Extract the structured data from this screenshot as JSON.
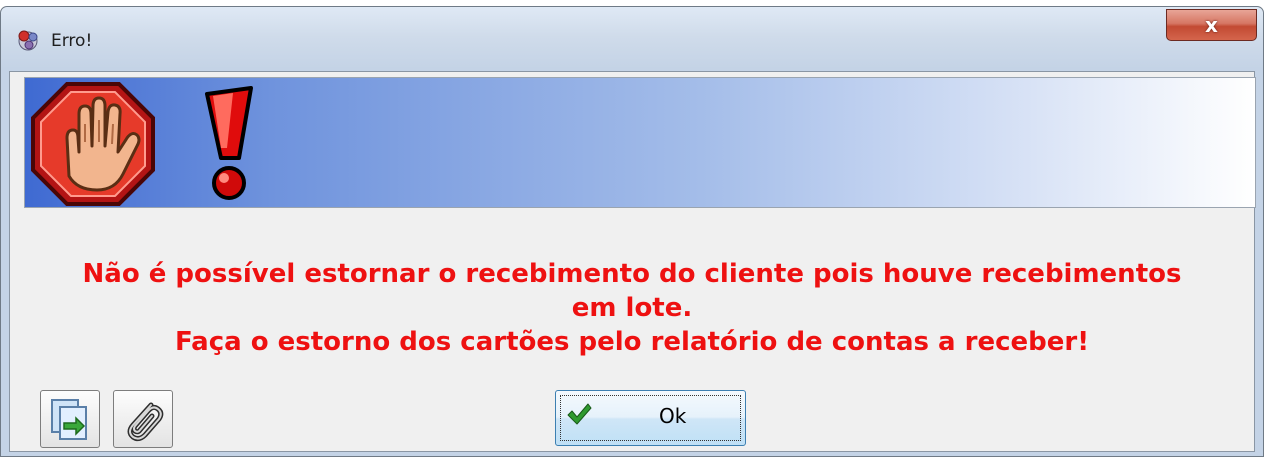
{
  "window": {
    "title": "Erro!",
    "close_label": "x",
    "icon": "app-icon"
  },
  "banner": {
    "icons": [
      "stop-hand-icon",
      "exclamation-icon"
    ],
    "gradient_colors": [
      "#3f6ad2",
      "#ffffff"
    ]
  },
  "message": {
    "lines": [
      "Não é possível estornar o recebimento do cliente pois houve recebimentos",
      "em lote.",
      "Faça o estorno dos cartões pelo relatório de contas a receber!"
    ],
    "color": "#ee1111"
  },
  "buttons": {
    "copy_icon": "copy-icon",
    "attach_icon": "paperclip-icon",
    "ok_label": "Ok",
    "ok_icon": "checkmark-icon"
  }
}
